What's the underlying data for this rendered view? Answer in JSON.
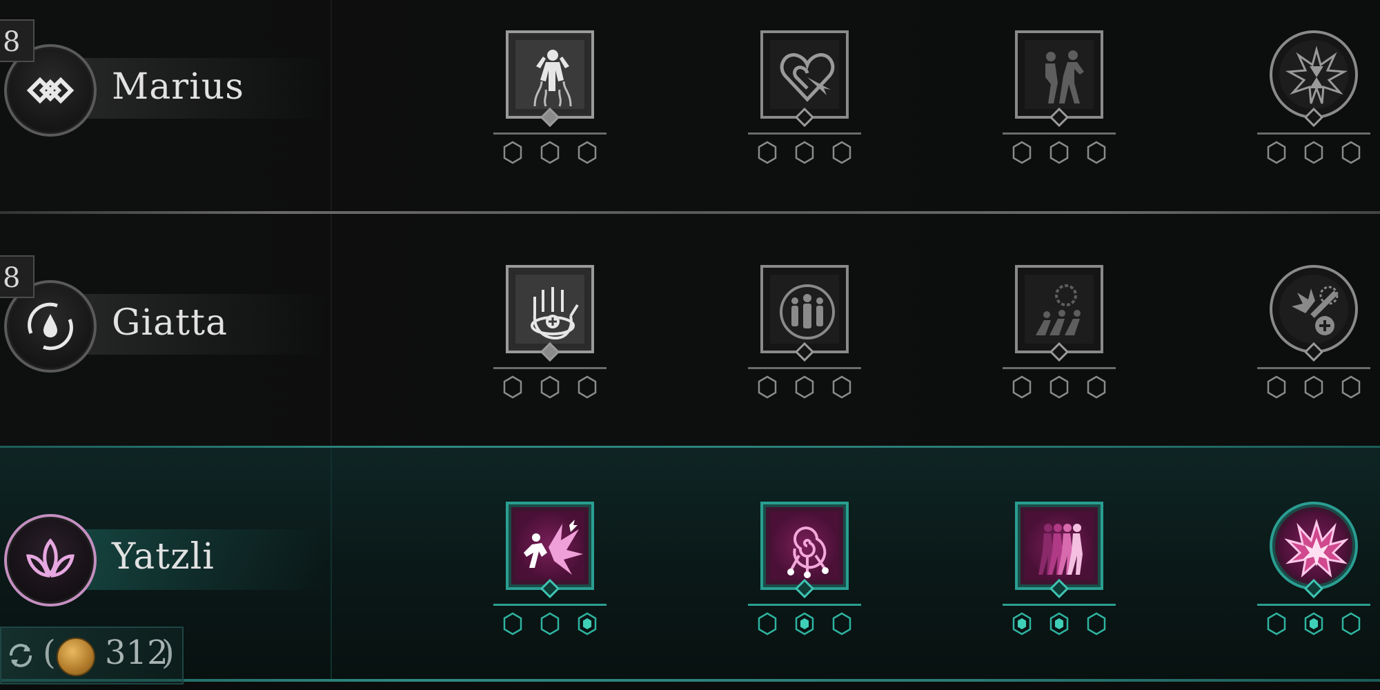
{
  "characters": [
    {
      "name": "Marius",
      "level": "8",
      "emblem_icon": "diamond-chain-icon",
      "skills": [
        {
          "icon": "rising-figure-icon",
          "selected": true,
          "shape": "square",
          "hexes": [
            "empty",
            "empty",
            "empty"
          ]
        },
        {
          "icon": "heart-target-icon",
          "selected": false,
          "shape": "square",
          "hexes": [
            "empty",
            "empty",
            "empty"
          ]
        },
        {
          "icon": "dash-figures-icon",
          "selected": false,
          "shape": "square",
          "hexes": [
            "empty",
            "empty",
            "empty"
          ]
        },
        {
          "icon": "hourglass-burst-icon",
          "selected": false,
          "shape": "round",
          "hexes": [
            "empty",
            "empty",
            "empty"
          ]
        }
      ]
    },
    {
      "name": "Giatta",
      "level": "8",
      "emblem_icon": "water-drop-cycle-icon",
      "skills": [
        {
          "icon": "healing-hand-icon",
          "selected": true,
          "shape": "square",
          "hexes": [
            "empty",
            "empty",
            "empty"
          ]
        },
        {
          "icon": "three-figures-icon",
          "selected": false,
          "shape": "square",
          "hexes": [
            "empty",
            "empty",
            "empty"
          ]
        },
        {
          "icon": "running-group-icon",
          "selected": false,
          "shape": "square",
          "hexes": [
            "empty",
            "empty",
            "empty"
          ]
        },
        {
          "icon": "burst-heal-icon",
          "selected": false,
          "shape": "round",
          "hexes": [
            "empty",
            "empty",
            "empty"
          ]
        }
      ]
    },
    {
      "name": "Yatzli",
      "level": "",
      "emblem_icon": "lotus-icon",
      "skills": [
        {
          "icon": "lightning-strike-icon",
          "selected": true,
          "shape": "square",
          "hexes": [
            "empty",
            "empty",
            "filled"
          ]
        },
        {
          "icon": "spiral-orbs-icon",
          "selected": true,
          "shape": "square",
          "hexes": [
            "empty",
            "filled",
            "empty"
          ]
        },
        {
          "icon": "afterimage-walk-icon",
          "selected": true,
          "shape": "square",
          "hexes": [
            "filled",
            "filled",
            "empty"
          ]
        },
        {
          "icon": "explosion-icon",
          "selected": true,
          "shape": "round",
          "hexes": [
            "empty",
            "filled",
            "empty"
          ]
        }
      ]
    }
  ],
  "respec": {
    "icon": "refresh-icon",
    "coin_icon": "coin-icon",
    "open_paren": "(",
    "cost": "312",
    "close_paren": ")"
  },
  "colors": {
    "accent_teal": "#2a9e92",
    "accent_pink": "#c48fc0",
    "neutral_frame": "#8a8a8a"
  }
}
